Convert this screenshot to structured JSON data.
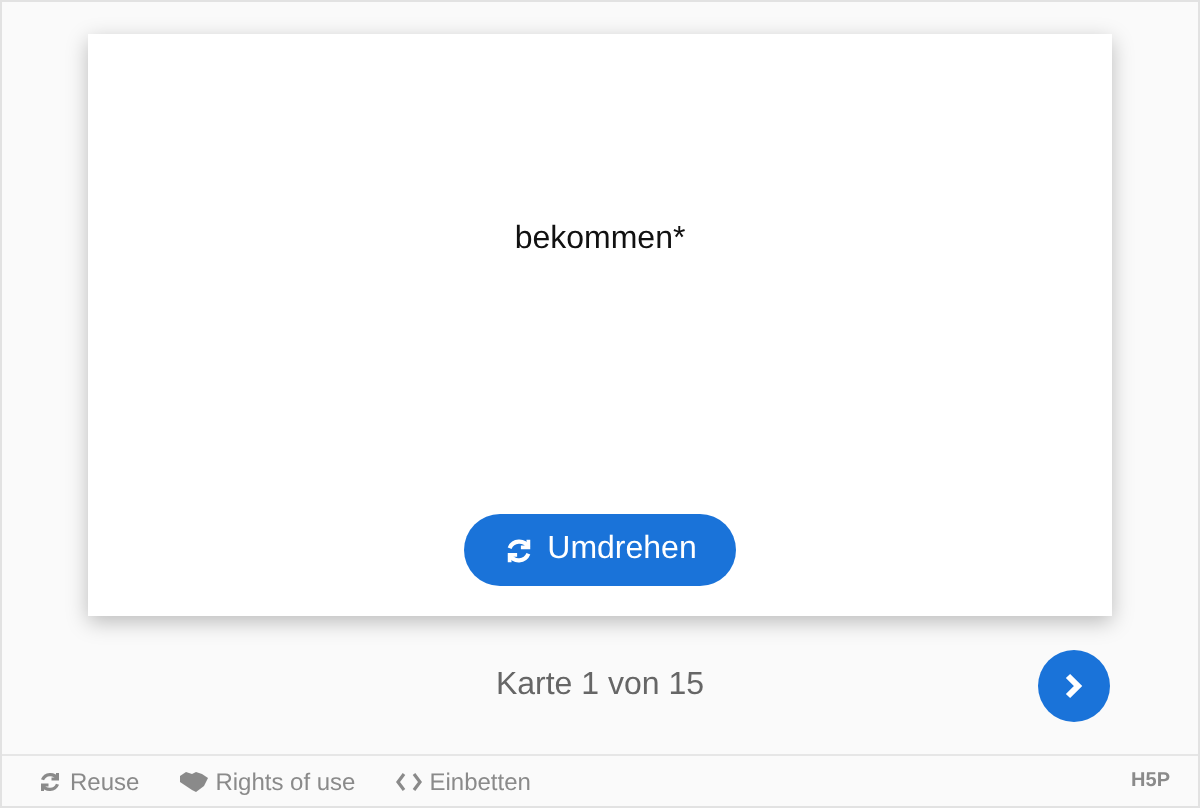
{
  "card": {
    "word": "bekommen*",
    "flip_button": "Umdrehen"
  },
  "progress": "Karte 1 von 15",
  "next_button": {
    "disabled": false
  },
  "footer": {
    "actions": [
      {
        "kind": "reuse",
        "label": "Reuse"
      },
      {
        "kind": "rights",
        "label": "Rights of use"
      },
      {
        "kind": "embed",
        "label": "Einbetten"
      }
    ],
    "logo": "H5P"
  }
}
